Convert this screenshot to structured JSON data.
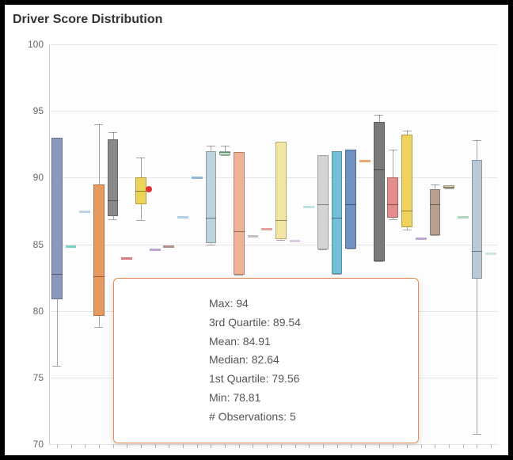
{
  "chart_data": {
    "type": "boxplot",
    "title": "Driver Score Distribution",
    "ylabel": "",
    "xlabel": "",
    "ylim": [
      70,
      100
    ],
    "yticks": [
      70,
      75,
      80,
      85,
      90,
      95,
      100
    ],
    "series": [
      {
        "min": 75.9,
        "q1": 80.9,
        "median": 82.8,
        "q3": 93.0,
        "max": 93.0,
        "color": "#8b97bf"
      },
      {
        "min": 84.9,
        "q1": 84.9,
        "median": 84.9,
        "q3": 84.9,
        "max": 84.9,
        "color": "#7fd0c8",
        "flat": true
      },
      {
        "min": 87.5,
        "q1": 87.5,
        "median": 87.5,
        "q3": 87.5,
        "max": 87.5,
        "color": "#bcd3e8",
        "flat": true
      },
      {
        "min": 78.8,
        "q1": 79.6,
        "median": 82.6,
        "q3": 89.5,
        "max": 94.0,
        "color": "#e79a5f"
      },
      {
        "min": 86.9,
        "q1": 87.1,
        "median": 88.3,
        "q3": 92.9,
        "max": 93.4,
        "color": "#898989"
      },
      {
        "min": 84.0,
        "q1": 84.0,
        "median": 84.0,
        "q3": 84.0,
        "max": 84.0,
        "color": "#d77a7a",
        "flat": true
      },
      {
        "min": 86.8,
        "q1": 88.0,
        "median": 89.0,
        "q3": 90.0,
        "max": 91.5,
        "color": "#ecd35a",
        "outlier": 89.1
      },
      {
        "min": 84.7,
        "q1": 84.7,
        "median": 84.7,
        "q3": 84.7,
        "max": 84.7,
        "color": "#bfa6cf",
        "flat": true
      },
      {
        "min": 84.9,
        "q1": 84.9,
        "median": 84.9,
        "q3": 84.9,
        "max": 84.9,
        "color": "#b38f87",
        "flat": true
      },
      {
        "min": 87.1,
        "q1": 87.1,
        "median": 87.1,
        "q3": 87.1,
        "max": 87.1,
        "color": "#aed0e6",
        "flat": true
      },
      {
        "min": 90.1,
        "q1": 90.1,
        "median": 90.1,
        "q3": 90.1,
        "max": 90.1,
        "color": "#8fb7d8",
        "flat": true
      },
      {
        "min": 85.0,
        "q1": 85.1,
        "median": 87.0,
        "q3": 92.0,
        "max": 92.4,
        "color": "#bcd3dd"
      },
      {
        "min": 91.7,
        "q1": 91.7,
        "median": 91.9,
        "q3": 92.0,
        "max": 92.4,
        "color": "#b9e2c8"
      },
      {
        "min": 82.7,
        "q1": 82.7,
        "median": 86.0,
        "q3": 91.9,
        "max": 91.9,
        "color": "#efb296"
      },
      {
        "min": 85.7,
        "q1": 85.7,
        "median": 85.7,
        "q3": 85.7,
        "max": 85.7,
        "color": "#c1c1c1",
        "flat": true
      },
      {
        "min": 86.2,
        "q1": 86.2,
        "median": 86.2,
        "q3": 86.2,
        "max": 86.2,
        "color": "#e0a2a2",
        "flat": true
      },
      {
        "min": 85.3,
        "q1": 85.4,
        "median": 86.8,
        "q3": 92.7,
        "max": 92.7,
        "color": "#f3e6a5"
      },
      {
        "min": 85.3,
        "q1": 85.3,
        "median": 85.3,
        "q3": 85.3,
        "max": 85.3,
        "color": "#dcc7e4",
        "flat": true
      },
      {
        "min": 87.9,
        "q1": 87.9,
        "median": 87.9,
        "q3": 87.9,
        "max": 87.9,
        "color": "#bde3e0",
        "flat": true
      },
      {
        "min": 84.6,
        "q1": 84.6,
        "median": 88.0,
        "q3": 91.7,
        "max": 91.7,
        "color": "#d4d4d4"
      },
      {
        "min": 82.8,
        "q1": 82.8,
        "median": 87.0,
        "q3": 92.0,
        "max": 92.0,
        "color": "#71c0d8"
      },
      {
        "min": 84.7,
        "q1": 84.7,
        "median": 88.0,
        "q3": 92.1,
        "max": 92.1,
        "color": "#6f92c2"
      },
      {
        "min": 91.3,
        "q1": 91.3,
        "median": 91.3,
        "q3": 91.3,
        "max": 91.3,
        "color": "#e6ab70",
        "flat": true
      },
      {
        "min": 83.7,
        "q1": 83.7,
        "median": 90.6,
        "q3": 94.2,
        "max": 94.7,
        "color": "#7a7a7a"
      },
      {
        "min": 86.9,
        "q1": 87.0,
        "median": 88.0,
        "q3": 90.0,
        "max": 92.1,
        "color": "#e48b8b"
      },
      {
        "min": 86.1,
        "q1": 86.3,
        "median": 87.5,
        "q3": 93.2,
        "max": 93.5,
        "color": "#efd35e"
      },
      {
        "min": 85.5,
        "q1": 85.5,
        "median": 85.5,
        "q3": 85.5,
        "max": 85.5,
        "color": "#c0a8d0",
        "flat": true
      },
      {
        "min": 85.7,
        "q1": 85.7,
        "median": 88.0,
        "q3": 89.1,
        "max": 89.5,
        "color": "#b8a08e"
      },
      {
        "min": 89.2,
        "q1": 89.2,
        "median": 89.3,
        "q3": 89.4,
        "max": 89.4,
        "color": "#d6ccb0"
      },
      {
        "min": 87.1,
        "q1": 87.1,
        "median": 87.1,
        "q3": 87.1,
        "max": 87.1,
        "color": "#b0d6b8",
        "flat": true
      },
      {
        "min": 70.8,
        "q1": 82.4,
        "median": 84.5,
        "q3": 91.3,
        "max": 92.8,
        "color": "#b8c9d8"
      },
      {
        "min": 84.4,
        "q1": 84.4,
        "median": 84.4,
        "q3": 84.4,
        "max": 84.4,
        "color": "#cde7dc",
        "flat": true
      }
    ],
    "tooltip_index": 3,
    "tooltip": {
      "rows": [
        {
          "label": "Max",
          "value": "94"
        },
        {
          "label": "3rd Quartile",
          "value": "89.54"
        },
        {
          "label": "Mean",
          "value": "84.91"
        },
        {
          "label": "Median",
          "value": "82.64"
        },
        {
          "label": "1st Quartile",
          "value": "79.56"
        },
        {
          "label": "Min",
          "value": "78.81"
        },
        {
          "label": "# Observations",
          "value": "5"
        }
      ]
    }
  }
}
